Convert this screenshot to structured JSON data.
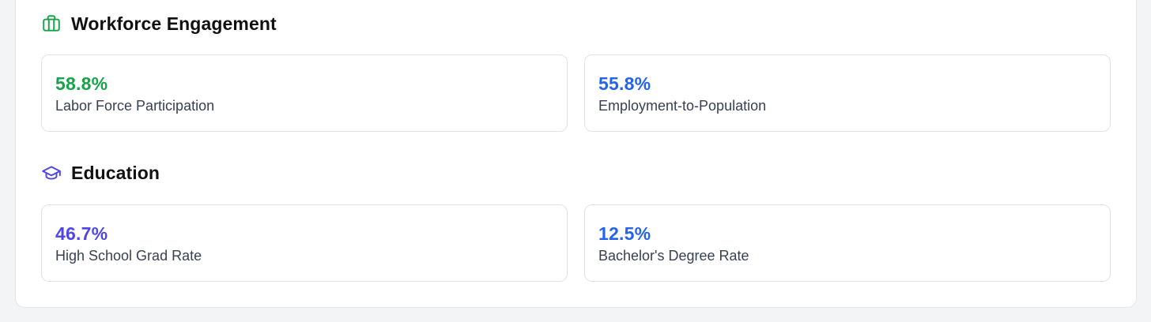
{
  "sections": {
    "workforce": {
      "title": "Workforce Engagement",
      "icon": "briefcase-icon",
      "icon_color": "#16a34a",
      "cards": [
        {
          "value": "58.8%",
          "label": "Labor Force Participation",
          "color": "#16a34a"
        },
        {
          "value": "55.8%",
          "label": "Employment-to-Population",
          "color": "#2563eb"
        }
      ]
    },
    "education": {
      "title": "Education",
      "icon": "graduation-cap-icon",
      "icon_color": "#4f46e5",
      "cards": [
        {
          "value": "46.7%",
          "label": "High School Grad Rate",
          "color": "#4f46e5"
        },
        {
          "value": "12.5%",
          "label": "Bachelor's Degree Rate",
          "color": "#2563eb"
        }
      ]
    }
  }
}
